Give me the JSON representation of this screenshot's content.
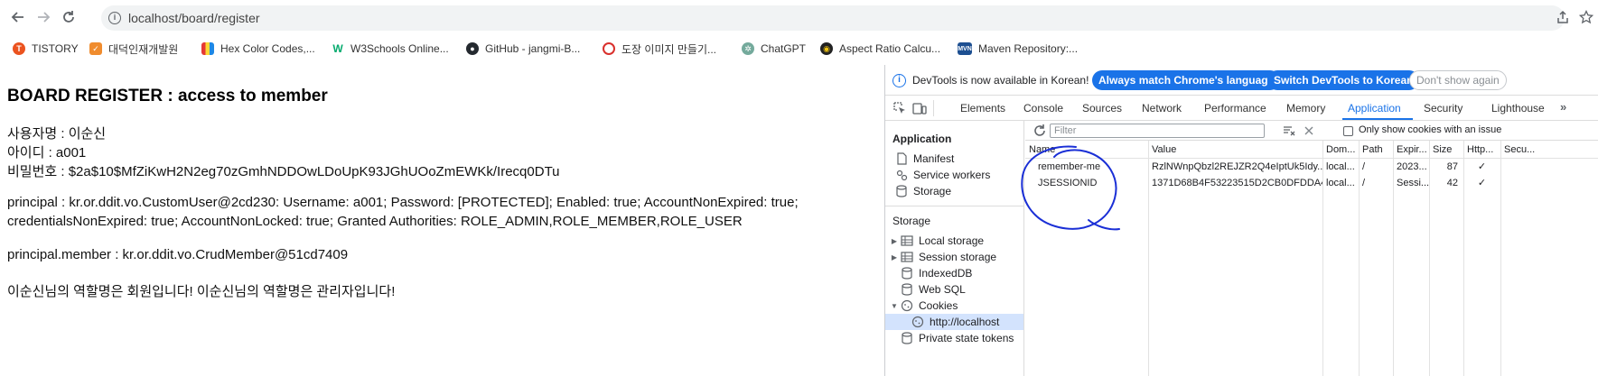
{
  "browser": {
    "url": "localhost/board/register",
    "bookmarks": [
      {
        "label": "TISTORY",
        "icon": "tistory-icon",
        "color": "#eb531f"
      },
      {
        "label": "대덕인재개발원",
        "icon": "ddit-icon",
        "color": "#f08c2e"
      },
      {
        "label": "Hex Color Codes,...",
        "icon": "color-icon",
        "color": "#3b5998"
      },
      {
        "label": "W3Schools Online...",
        "icon": "w3schools-icon",
        "color": "#04aa6d"
      },
      {
        "label": "GitHub - jangmi-B...",
        "icon": "github-icon",
        "color": "#24292f"
      },
      {
        "label": "도장 이미지 만들기...",
        "icon": "stamp-icon",
        "color": "#d9302c"
      },
      {
        "label": "ChatGPT",
        "icon": "chatgpt-icon",
        "color": "#74aa9c"
      },
      {
        "label": "Aspect Ratio Calcu...",
        "icon": "aspect-icon",
        "color": "#f1c40f"
      },
      {
        "label": "Maven Repository:...",
        "icon": "maven-icon",
        "color": "#1d4f91"
      }
    ]
  },
  "page": {
    "title": "BOARD REGISTER : access to member",
    "username_line": "사용자명 : 이순신",
    "userid_line": "아이디 : a001",
    "password_line": "비밀번호 : $2a$10$MfZiKwH2N2eg70zGmhNDDOwLDoUpK93JGhUOoZmEWKk/Irecq0DTu",
    "principal_line1": "principal : kr.or.ddit.vo.CustomUser@2cd230: Username: a001; Password: [PROTECTED]; Enabled: true; AccountNonExpired: true;",
    "principal_line2": "credentialsNonExpired: true; AccountNonLocked: true; Granted Authorities: ROLE_ADMIN,ROLE_MEMBER,ROLE_USER",
    "member_line": "principal.member : kr.or.ddit.vo.CrudMember@51cd7409",
    "role_line": "이순신님의 역할명은 회원입니다! 이순신님의 역할명은 관리자입니다!"
  },
  "devtools": {
    "info_text": "DevTools is now available in Korean!",
    "btn_match": "Always match Chrome's language",
    "btn_switch": "Switch DevTools to Korean",
    "btn_dismiss": "Don't show again",
    "tabs": [
      "Elements",
      "Console",
      "Sources",
      "Network",
      "Performance",
      "Memory",
      "Application",
      "Security",
      "Lighthouse"
    ],
    "active_tab": "Application",
    "sidebar": {
      "application_heading": "Application",
      "application_items": [
        "Manifest",
        "Service workers",
        "Storage"
      ],
      "storage_heading": "Storage",
      "storage_items": [
        "Local storage",
        "Session storage",
        "IndexedDB",
        "Web SQL",
        "Cookies",
        "http://localhost",
        "Private state tokens"
      ]
    },
    "filter_placeholder": "Filter",
    "only_issue_label": "Only show cookies with an issue",
    "columns": [
      "Name",
      "Value",
      "Dom...",
      "Path",
      "Expir...",
      "Size",
      "Http...",
      "Secu..."
    ],
    "cookies": [
      {
        "name": "remember-me",
        "value": "RzlNWnpQbzl2REJZR2Q4eIptUk5Idy...",
        "domain": "local...",
        "path": "/",
        "expires": "2023...",
        "size": "87",
        "http": "✓"
      },
      {
        "name": "JSESSIONID",
        "value": "1371D68B4F53223515D2CB0DFDDA4...",
        "domain": "local...",
        "path": "/",
        "expires": "Sessi...",
        "size": "42",
        "http": "✓"
      }
    ],
    "accent_color": "#1a73e8"
  }
}
